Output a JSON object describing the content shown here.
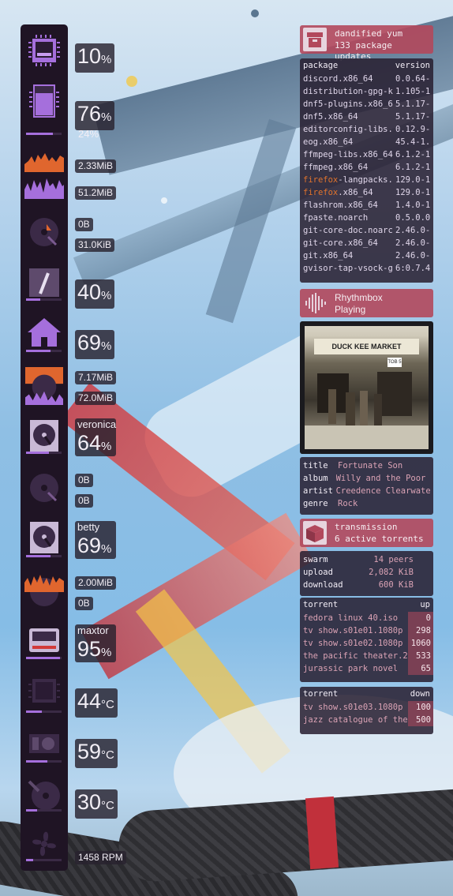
{
  "colors": {
    "accent": "#a56fdc",
    "panel": "#1f1424",
    "header": "#b2485c"
  },
  "system": {
    "cpu": {
      "icon": "cpu-icon",
      "value": "10",
      "unit": "%"
    },
    "memory": {
      "icon": "memory-icon",
      "value": "76",
      "unit": "%",
      "swap": "24%",
      "level": 0.76
    },
    "network": {
      "icon": "network-graph-icon",
      "down": "2.33MiB",
      "up": "51.2MiB"
    },
    "disk_io_1": {
      "icon": "disk-io-icon",
      "read": "0B",
      "write": "31.0KiB"
    },
    "root_fs": {
      "icon": "root-disk-icon",
      "value": "40",
      "unit": "%",
      "level": 0.4
    },
    "home_fs": {
      "icon": "home-icon",
      "value": "69",
      "unit": "%",
      "level": 0.69
    },
    "disk_io_2": {
      "icon": "disk-io-icon",
      "read": "7.17MiB",
      "write": "72.0MiB"
    },
    "veronica": {
      "icon": "drive-icon",
      "name": "veronica",
      "value": "64",
      "unit": "%",
      "level": 0.64
    },
    "disk_io_3": {
      "icon": "disk-io-icon",
      "read": "0B",
      "write": "0B"
    },
    "betty": {
      "icon": "drive-icon",
      "name": "betty",
      "value": "69",
      "unit": "%",
      "level": 0.69
    },
    "disk_io_4": {
      "icon": "disk-io-icon",
      "read": "2.00MiB",
      "write": "0B"
    },
    "maxtor": {
      "icon": "external-drive-icon",
      "name": "maxtor",
      "value": "95",
      "unit": "%",
      "level": 0.95
    },
    "cpu_temp": {
      "icon": "cpu-temp-icon",
      "value": "44",
      "unit": "°C"
    },
    "gpu_temp": {
      "icon": "gpu-icon",
      "value": "59",
      "unit": "°C"
    },
    "disk_temp": {
      "icon": "disk-temp-icon",
      "value": "30",
      "unit": "°C"
    },
    "fan": {
      "icon": "fan-icon",
      "value": "1458 RPM"
    }
  },
  "dnf": {
    "icon": "package-box-icon",
    "title": "dandified yum",
    "subtitle": "133 package updates",
    "col_package": "package",
    "col_version": "version",
    "rows": [
      {
        "name": "discord.x86_64",
        "version": "0.0.64-",
        "hl": ""
      },
      {
        "name": "distribution-gpg-k",
        "version": "1.105-1",
        "hl": ""
      },
      {
        "name": "dnf5-plugins.x86_6",
        "version": "5.1.17-",
        "hl": ""
      },
      {
        "name": "dnf5.x86_64",
        "version": "5.1.17-",
        "hl": ""
      },
      {
        "name": "editorconfig-libs.",
        "version": "0.12.9-",
        "hl": ""
      },
      {
        "name": "eog.x86_64",
        "version": "45.4-1.",
        "hl": ""
      },
      {
        "name": "ffmpeg-libs.x86_64",
        "version": "6.1.2-1",
        "hl": ""
      },
      {
        "name": "ffmpeg.x86_64",
        "version": "6.1.2-1",
        "hl": ""
      },
      {
        "name": "-langpacks.",
        "version": "129.0-1",
        "hl": "firefox"
      },
      {
        "name": ".x86_64",
        "version": "129.0-1",
        "hl": "firefox"
      },
      {
        "name": "flashrom.x86_64",
        "version": "1.4.0-1",
        "hl": ""
      },
      {
        "name": "fpaste.noarch",
        "version": "0.5.0.0",
        "hl": ""
      },
      {
        "name": "git-core-doc.noarc",
        "version": "2.46.0-",
        "hl": ""
      },
      {
        "name": "git-core.x86_64",
        "version": "2.46.0-",
        "hl": ""
      },
      {
        "name": "git.x86_64",
        "version": "2.46.0-",
        "hl": ""
      },
      {
        "name": "gvisor-tap-vsock-g",
        "version": "6:0.7.4",
        "hl": ""
      }
    ]
  },
  "rhythmbox": {
    "icon": "audio-waveform-icon",
    "title": "Rhythmbox",
    "status": "Playing",
    "cover_top": "DUCK KEE MARKET",
    "cover_sign": "TOB 5",
    "meta": [
      {
        "key": "title",
        "value": "Fortunate Son"
      },
      {
        "key": "album",
        "value": "Willy and the Poor B"
      },
      {
        "key": "artist",
        "value": "Creedence Clearwater"
      },
      {
        "key": "genre",
        "value": "Rock"
      }
    ]
  },
  "transmission": {
    "icon": "package-open-icon",
    "title": "transmission",
    "subtitle": "6 active torrents",
    "stats": [
      {
        "key": "swarm",
        "value": "14 peers"
      },
      {
        "key": "upload",
        "value": "2,082 KiB"
      },
      {
        "key": "download",
        "value": "600 KiB"
      }
    ],
    "seeding": {
      "col_name": "torrent",
      "col_value": "up",
      "rows": [
        {
          "name": "fedora linux 40.iso",
          "value": "0"
        },
        {
          "name": "tv show.s01e01.1080p",
          "value": "298"
        },
        {
          "name": "tv show.s01e02.1080p",
          "value": "1060"
        },
        {
          "name": "the pacific theater.20",
          "value": "533"
        },
        {
          "name": "jurassic park novel",
          "value": "65"
        }
      ]
    },
    "downloading": {
      "col_name": "torrent",
      "col_value": "down",
      "rows": [
        {
          "name": "tv show.s01e03.1080p",
          "value": "100"
        },
        {
          "name": "jazz catalogue of the",
          "value": "500"
        }
      ]
    }
  }
}
